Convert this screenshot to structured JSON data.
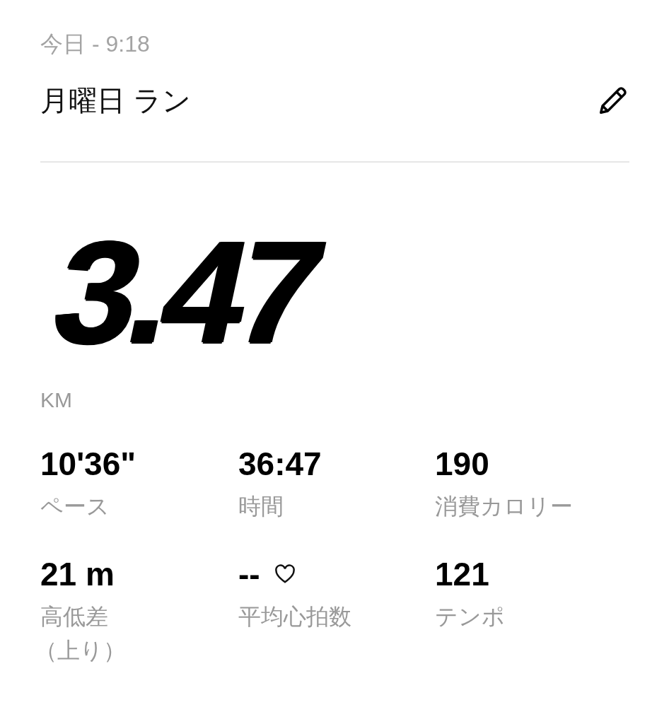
{
  "header": {
    "timestamp": "今日 - 9:18",
    "title": "月曜日 ラン"
  },
  "distance": {
    "value": "3.47",
    "unit": "KM"
  },
  "stats": [
    {
      "value": "10'36\"",
      "label": "ペース",
      "heart": false
    },
    {
      "value": "36:47",
      "label": "時間",
      "heart": false
    },
    {
      "value": "190",
      "label": "消費カロリー",
      "heart": false
    },
    {
      "value": "21 m",
      "label": "高低差",
      "note": "（上り）",
      "heart": false
    },
    {
      "value": "--",
      "label": "平均心拍数",
      "heart": true
    },
    {
      "value": "121",
      "label": "テンポ",
      "heart": false
    }
  ]
}
